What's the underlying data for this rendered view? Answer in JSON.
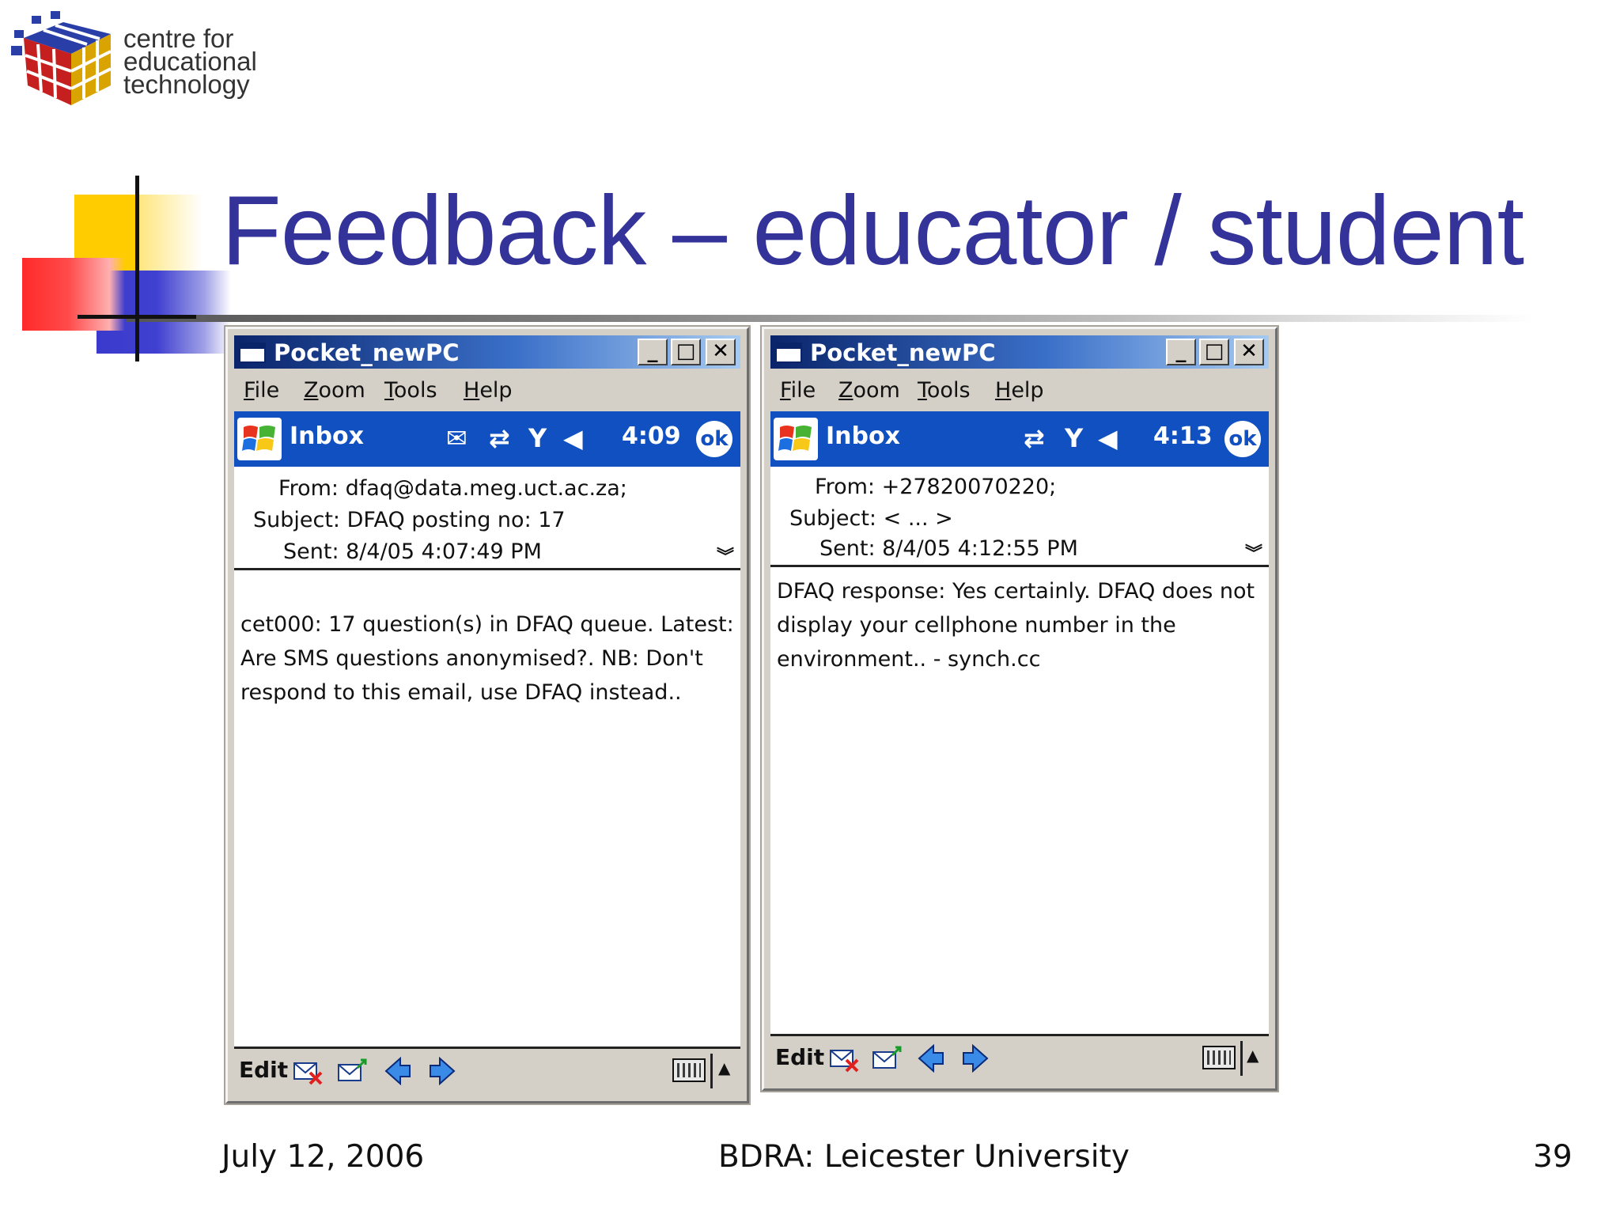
{
  "logo": {
    "line1": "centre for",
    "line2": "educational",
    "line3": "technology"
  },
  "slide": {
    "title": "Feedback – educator / student"
  },
  "windows": [
    {
      "window_title": "Pocket_newPC",
      "menu": [
        "File",
        "Zoom",
        "Tools",
        "Help"
      ],
      "nav_title": "Inbox",
      "time": "4:09",
      "ok_label": "ok",
      "from": "From: dfaq@data.meg.uct.ac.za;",
      "subject": "Subject: DFAQ posting no: 17",
      "sent": "Sent: 8/4/05 4:07:49 PM",
      "body_lines": [
        "cet000: 17 question(s) in DFAQ queue. Latest:",
        "Are SMS questions anonymised?. NB: Don't",
        "respond to this email, use DFAQ instead.."
      ],
      "edit_label": "Edit"
    },
    {
      "window_title": "Pocket_newPC",
      "menu": [
        "File",
        "Zoom",
        "Tools",
        "Help"
      ],
      "nav_title": "Inbox",
      "time": "4:13",
      "ok_label": "ok",
      "from": "From: +27820070220;",
      "subject": "Subject: < ... >",
      "sent": "Sent: 8/4/05 4:12:55 PM",
      "body_lines": [
        "DFAQ response: Yes certainly. DFAQ does not",
        "display your cellphone number in the",
        "environment.. - synch.cc"
      ],
      "edit_label": "Edit"
    }
  ],
  "icons": {
    "minimize": "minimize-icon",
    "maximize": "maximize-icon",
    "close": "close-icon",
    "mail": "envelope-icon",
    "sync": "sync-arrows-icon",
    "signal": "signal-icon",
    "speaker": "speaker-icon",
    "expand": "chevron-double-down-icon",
    "delete": "delete-mail-icon",
    "reply": "reply-mail-icon",
    "prev": "arrow-left-icon",
    "next": "arrow-right-icon",
    "keyboard": "keyboard-icon"
  },
  "colors": {
    "title": "#333399",
    "navbar": "#1050c0",
    "titlebar_start": "#0a246a",
    "titlebar_end": "#a6caf0",
    "chrome": "#d4d0c8"
  },
  "footer": {
    "date": "July 12, 2006",
    "center": "BDRA: Leicester University",
    "page": "39"
  }
}
